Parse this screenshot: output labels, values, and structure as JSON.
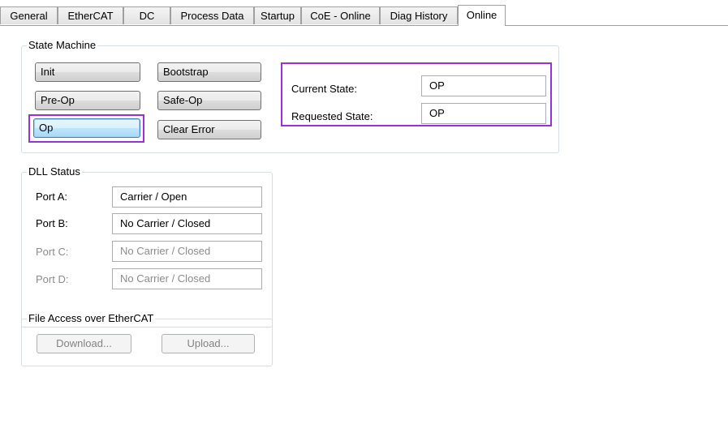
{
  "tabs": [
    {
      "label": "General",
      "active": false
    },
    {
      "label": "EtherCAT",
      "active": false
    },
    {
      "label": "DC",
      "active": false
    },
    {
      "label": "Process Data",
      "active": false
    },
    {
      "label": "Startup",
      "active": false
    },
    {
      "label": "CoE - Online",
      "active": false
    },
    {
      "label": "Diag History",
      "active": false
    },
    {
      "label": "Online",
      "active": true
    }
  ],
  "state_machine": {
    "legend": "State Machine",
    "buttons": {
      "init": "Init",
      "bootstrap": "Bootstrap",
      "preop": "Pre-Op",
      "safeop": "Safe-Op",
      "op": "Op",
      "clear_error": "Clear Error"
    },
    "current_state_label": "Current State:",
    "current_state_value": "OP",
    "requested_state_label": "Requested State:",
    "requested_state_value": "OP"
  },
  "dll_status": {
    "legend": "DLL Status",
    "ports": [
      {
        "label": "Port A:",
        "value": "Carrier / Open",
        "enabled": true
      },
      {
        "label": "Port B:",
        "value": "No Carrier / Closed",
        "enabled": true
      },
      {
        "label": "Port C:",
        "value": "No Carrier / Closed",
        "enabled": false
      },
      {
        "label": "Port D:",
        "value": "No Carrier / Closed",
        "enabled": false
      }
    ]
  },
  "file_access": {
    "legend": "File Access over EtherCAT",
    "download_label": "Download...",
    "upload_label": "Upload..."
  },
  "colors": {
    "highlight": "#9b2fd8",
    "focus_button": "#bee6fd",
    "group_border": "#d5dfe5"
  }
}
